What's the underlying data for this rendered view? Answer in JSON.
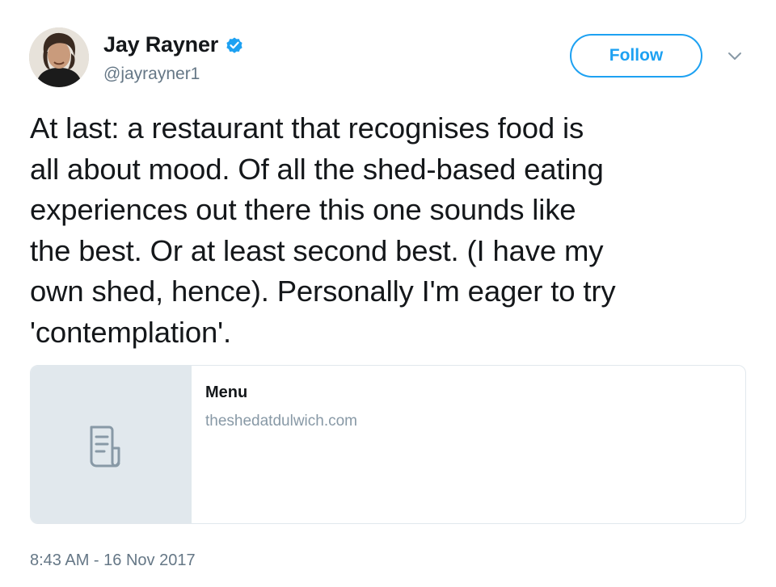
{
  "tweet": {
    "author": {
      "display_name": "Jay Rayner",
      "handle": "@jayrayner1",
      "verified": true,
      "avatar_icon": "user-avatar"
    },
    "follow_label": "Follow",
    "menu_icon": "chevron-down-icon",
    "text": "At last: a restaurant that recognises food is\nall about mood. Of all the shed-based eating\nexperiences out there this one sounds like\nthe best. Or at least second best. (I have my\nown shed, hence). Personally I'm eager to try\n'contemplation'.",
    "card": {
      "title": "Menu",
      "domain": "theshedatdulwich.com",
      "thumbnail_icon": "document-icon"
    },
    "timestamp": "8:43 AM - 16 Nov 2017"
  },
  "colors": {
    "accent": "#1da1f2",
    "text_primary": "#14171a",
    "text_secondary": "#657786",
    "border": "#e1e8ed"
  }
}
